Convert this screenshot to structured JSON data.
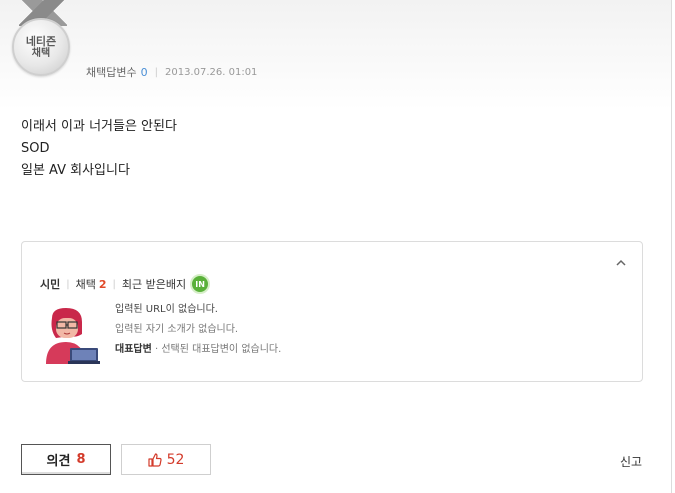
{
  "medal": {
    "line1": "네티즌",
    "line2": "채택"
  },
  "meta": {
    "adopt_label": "채택답변수",
    "adopt_count": "0",
    "datetime": "2013.07.26. 01:01"
  },
  "answer": {
    "text": "이래서 이과 너거들은 안된다\nSOD\n일본 AV 회사입니다"
  },
  "profile": {
    "grade": "시민",
    "adopt_label": "채택",
    "adopt_count": "2",
    "badge_label": "최근 받은배지",
    "badge_text": "IN",
    "url_text": "입력된 URL이 없습니다.",
    "intro_text": "입력된 자기 소개가 없습니다.",
    "rep_label": "대표답변",
    "rep_value": "· 선택된 대표답변이 없습니다."
  },
  "actions": {
    "opinion_label": "의견",
    "opinion_count": "8",
    "like_count": "52",
    "report_label": "신고"
  },
  "colors": {
    "accent_red": "#d33b2b",
    "badge_green": "#5ab13a",
    "count_blue": "#4a8fd6"
  }
}
